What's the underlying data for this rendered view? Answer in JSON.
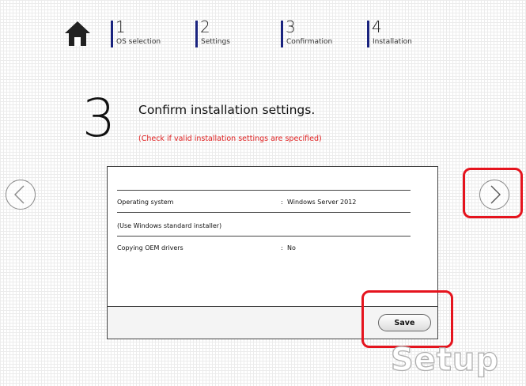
{
  "steps": [
    {
      "number": "1",
      "label": "OS selection"
    },
    {
      "number": "2",
      "label": "Settings"
    },
    {
      "number": "3",
      "label": "Confirmation"
    },
    {
      "number": "4",
      "label": "Installation"
    }
  ],
  "main": {
    "step_number": "3",
    "title": "Confirm installation settings.",
    "subtitle": "(Check if valid installation settings are specified)"
  },
  "settings": [
    {
      "label": "Operating system",
      "separator": ":",
      "value": "Windows Server 2012"
    },
    {
      "label": "(Use Windows standard installer)"
    },
    {
      "label": "Copying OEM drivers",
      "separator": ":",
      "value": "No"
    }
  ],
  "buttons": {
    "save_label": "Save"
  },
  "watermark": "Setup",
  "colors": {
    "highlight": "#e5141e",
    "step_bar": "#1a237e",
    "warning_text": "#e02020"
  },
  "icons": {
    "home": "home-icon",
    "prev": "chevron-left-circle-icon",
    "next": "chevron-right-circle-icon"
  }
}
